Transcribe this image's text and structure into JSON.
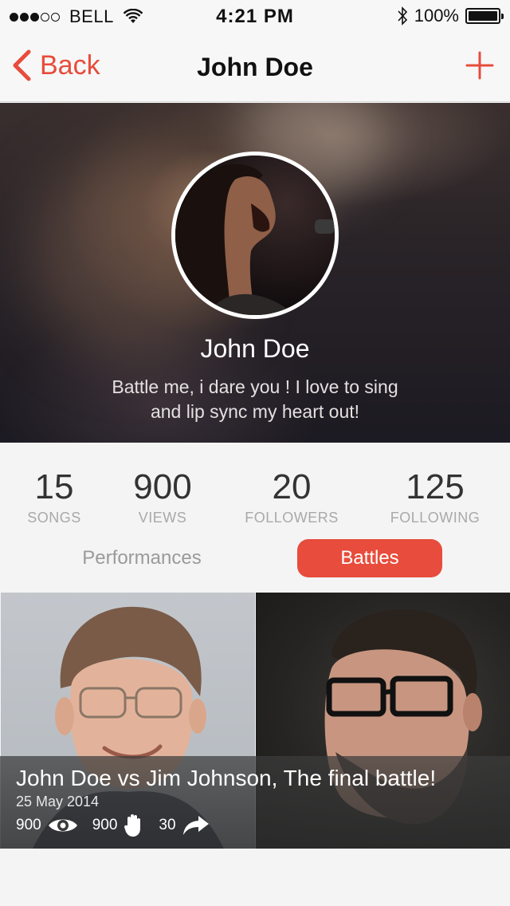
{
  "status_bar": {
    "carrier": "BELL",
    "time": "4:21 PM",
    "battery": "100%"
  },
  "nav": {
    "back_label": "Back",
    "title": "John Doe"
  },
  "profile": {
    "name": "John Doe",
    "bio": "Battle me, i dare you ! I love to sing and lip sync my heart out!"
  },
  "stats": [
    {
      "value": "15",
      "label": "SONGS"
    },
    {
      "value": "900",
      "label": "VIEWS"
    },
    {
      "value": "20",
      "label": "FOLLOWERS"
    },
    {
      "value": "125",
      "label": "FOLLOWING"
    }
  ],
  "tabs": {
    "performances": "Performances",
    "battles": "Battles",
    "active": "Battles"
  },
  "battle": {
    "title": "John Doe vs Jim Johnson, The final battle!",
    "date": "25 May 2014",
    "views": "900",
    "claps": "900",
    "shares": "30"
  },
  "colors": {
    "accent": "#e74c3c",
    "background": "#f4f4f4"
  },
  "icons": [
    "back-chevron-icon",
    "add-icon",
    "wifi-icon",
    "bluetooth-icon",
    "battery-icon",
    "eye-icon",
    "hand-icon",
    "share-arrow-icon"
  ]
}
